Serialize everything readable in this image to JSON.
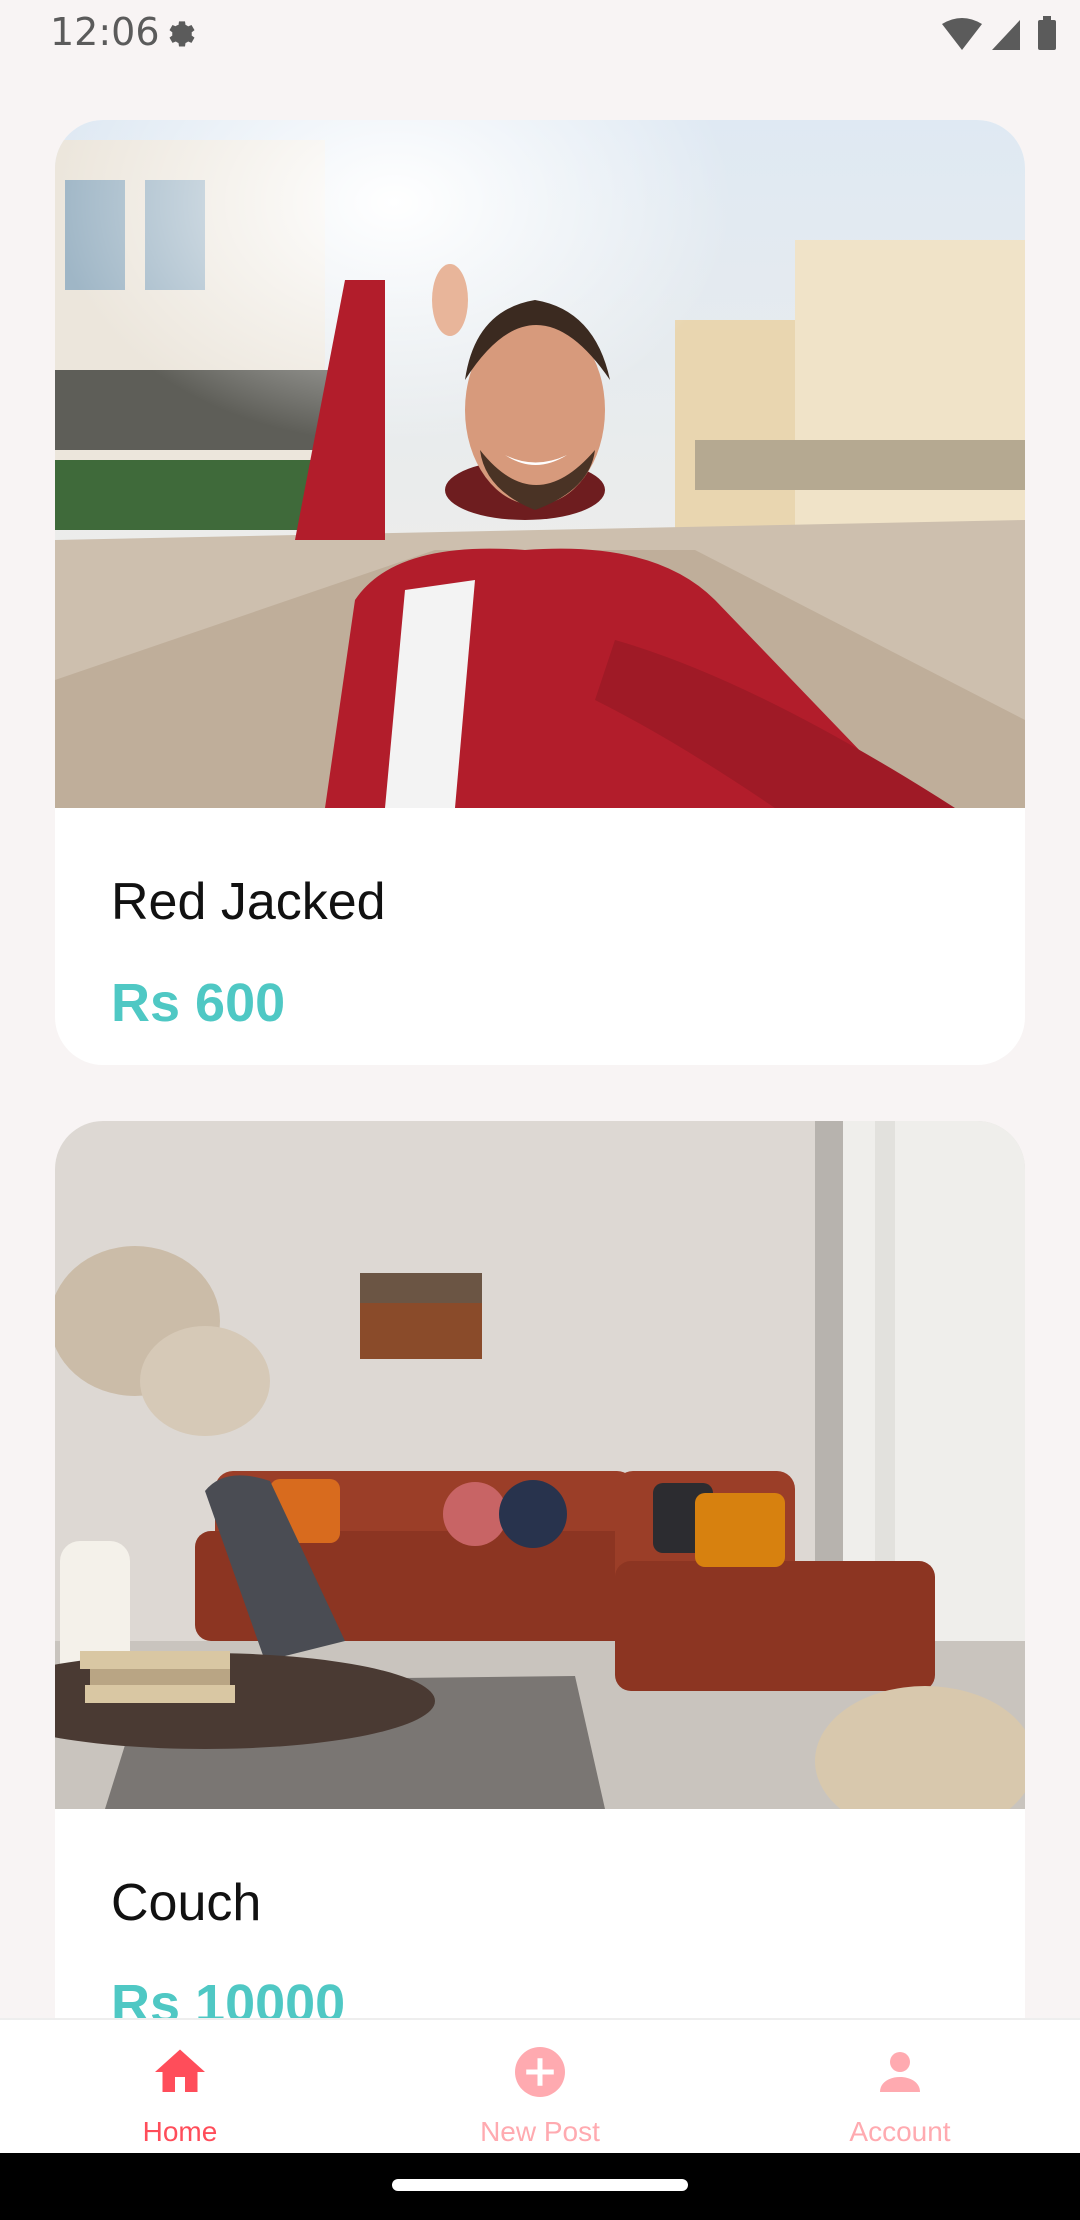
{
  "status_bar": {
    "time": "12:06",
    "icons": [
      "settings-icon",
      "wifi-icon",
      "signal-icon",
      "battery-icon"
    ]
  },
  "feed": {
    "cards": [
      {
        "title": "Red Jacked",
        "price": "Rs 600",
        "image": "photo of smiling man in red jacket taking selfie on street"
      },
      {
        "title": "Couch",
        "price": "Rs 10000",
        "image": "photo of living room with rust orange sectional couch"
      }
    ]
  },
  "bottom_nav": {
    "items": [
      {
        "label": "Home",
        "icon": "home-icon",
        "active": true
      },
      {
        "label": "New Post",
        "icon": "add-circle-icon",
        "active": false
      },
      {
        "label": "Account",
        "icon": "person-icon",
        "active": false
      }
    ]
  },
  "colors": {
    "background": "#f8f4f4",
    "price": "#4fc8c4",
    "nav_active": "#ff4d5a",
    "nav_inactive": "#ffaab0"
  }
}
